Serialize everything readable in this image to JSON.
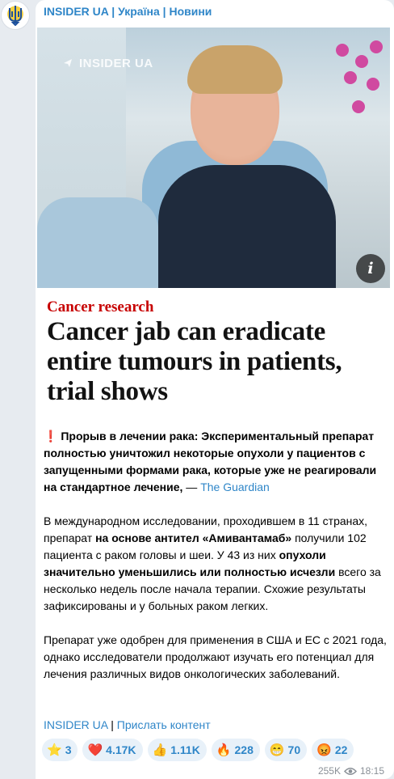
{
  "channel": {
    "name": "INSIDER UA | Україна | Новини"
  },
  "photo": {
    "watermark": "INSIDER UA"
  },
  "article_card": {
    "kicker": "Cancer research",
    "headline": "Cancer jab can eradicate entire tumours in patients, trial shows"
  },
  "post": {
    "p1_bold": "Прорыв в лечении рака: Экспериментальный препарат полностью уничтожил некоторые опухоли у пациентов с запущенными формами рака, которые уже не реагировали на стандартное лечение,",
    "p1_sep": " — ",
    "p1_link": "The Guardian",
    "p2_a": "В международном исследовании, проходившем в 11 странах, препарат ",
    "p2_b": "на основе антител «Амивантамаб»",
    "p2_c": " получили 102 пациента с раком головы и шеи. У 43 из них ",
    "p2_d": "опухоли значительно уменьшились или полностью исчезли",
    "p2_e": " всего за несколько недель после начала терапии. Схожие результаты зафиксированы и у больных раком легких.",
    "p3": "Препарат уже одобрен для применения в США и ЕС с 2021 года, однако исследователи продолжают изучать его потенциал для лечения различных видов онкологических заболеваний.",
    "footer_link1": "INSIDER UA",
    "footer_sep": " | ",
    "footer_link2": "Прислать контент"
  },
  "reactions": [
    {
      "icon": "star-icon",
      "emoji": "⭐",
      "count": "3"
    },
    {
      "icon": "heart-icon",
      "emoji": "❤️",
      "count": "4.17K"
    },
    {
      "icon": "thumbs-up-icon",
      "emoji": "👍",
      "count": "1.11K"
    },
    {
      "icon": "fire-icon",
      "emoji": "🔥",
      "count": "228"
    },
    {
      "icon": "grin-icon",
      "emoji": "😁",
      "count": "70"
    },
    {
      "icon": "angry-icon",
      "emoji": "😡",
      "count": "22"
    }
  ],
  "meta": {
    "views": "255K",
    "time": "18:15"
  },
  "colors": {
    "link": "#2f86c8",
    "kicker": "#c70000",
    "background": "#e7ebf0"
  }
}
